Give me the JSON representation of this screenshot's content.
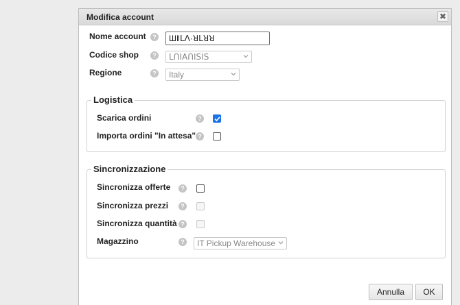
{
  "dialog": {
    "title": "Modifica account",
    "close_icon": "close-icon"
  },
  "account": {
    "name_label": "Nome account",
    "name_value": "Ш‖ꓡꓥ·ꓤꓡꓤꓤ",
    "shop_label": "Codice shop",
    "shop_value": "ꓡꓵꓲꓮꓵꓲꓢꓲꓢ",
    "region_label": "Regione",
    "region_value": "Italy"
  },
  "logistica": {
    "legend": "Logistica",
    "scarica_label": "Scarica ordini",
    "scarica_checked": true,
    "importa_label": "Importa ordini \"In attesa\"",
    "importa_checked": false
  },
  "sync": {
    "legend": "Sincronizzazione",
    "offerte_label": "Sincronizza offerte",
    "prezzi_label": "Sincronizza prezzi",
    "quantita_label": "Sincronizza quantità",
    "magazzino_label": "Magazzino",
    "magazzino_value": "IT Pickup Warehouse"
  },
  "footer": {
    "cancel_label": "Annulla",
    "ok_label": "OK"
  },
  "help_glyph": "?"
}
